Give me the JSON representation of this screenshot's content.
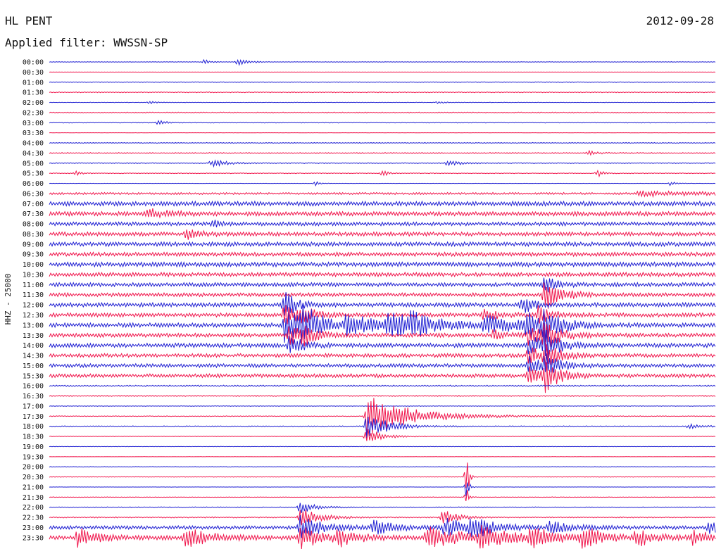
{
  "header": {
    "station": "HL PENT",
    "date": "2012-09-28",
    "filter": "Applied filter: WWSSN-SP"
  },
  "chart_data": {
    "type": "line",
    "title": "HL PENT",
    "ylabel": "HHZ - 25000",
    "x_range_minutes": [
      0,
      30
    ],
    "colors": {
      "even": "#1e1ed2",
      "odd": "#f0144b"
    },
    "rows": [
      {
        "label": "00:00",
        "noise": 0.4,
        "events": [
          {
            "t": 7.0,
            "a": 4,
            "d": 0.2
          },
          {
            "t": 8.5,
            "a": 6,
            "d": 0.4
          }
        ]
      },
      {
        "label": "00:30",
        "noise": 0.2,
        "events": []
      },
      {
        "label": "01:00",
        "noise": 0.5,
        "events": []
      },
      {
        "label": "01:30",
        "noise": 0.6,
        "events": []
      },
      {
        "label": "02:00",
        "noise": 0.3,
        "events": [
          {
            "t": 4.5,
            "a": 2,
            "d": 0.3
          },
          {
            "t": 17.5,
            "a": 2,
            "d": 0.3
          }
        ]
      },
      {
        "label": "02:30",
        "noise": 0.7,
        "events": []
      },
      {
        "label": "03:00",
        "noise": 0.5,
        "events": [
          {
            "t": 4.9,
            "a": 4,
            "d": 0.3
          }
        ]
      },
      {
        "label": "03:30",
        "noise": 0.2,
        "events": []
      },
      {
        "label": "04:00",
        "noise": 0.6,
        "events": []
      },
      {
        "label": "04:30",
        "noise": 0.8,
        "events": [
          {
            "t": 24.3,
            "a": 3,
            "d": 0.4
          }
        ]
      },
      {
        "label": "05:00",
        "noise": 0.6,
        "events": [
          {
            "t": 7.3,
            "a": 6,
            "d": 0.6
          },
          {
            "t": 17.9,
            "a": 4,
            "d": 0.6
          }
        ]
      },
      {
        "label": "05:30",
        "noise": 0.5,
        "events": [
          {
            "t": 1.2,
            "a": 4,
            "d": 0.2
          },
          {
            "t": 15.0,
            "a": 6,
            "d": 0.2
          },
          {
            "t": 24.7,
            "a": 6,
            "d": 0.2
          }
        ]
      },
      {
        "label": "06:00",
        "noise": 0.2,
        "events": [
          {
            "t": 12.0,
            "a": 3,
            "d": 0.2
          },
          {
            "t": 28.0,
            "a": 4,
            "d": 0.2
          }
        ]
      },
      {
        "label": "06:30",
        "noise": 1.5,
        "events": [
          {
            "t": 26.5,
            "a": 4,
            "d": 3.0
          }
        ]
      },
      {
        "label": "07:00",
        "noise": 3.2,
        "events": []
      },
      {
        "label": "07:30",
        "noise": 3.0,
        "events": [
          {
            "t": 4.4,
            "a": 7,
            "d": 0.8
          }
        ]
      },
      {
        "label": "08:00",
        "noise": 2.6,
        "events": [
          {
            "t": 7.4,
            "a": 4,
            "d": 0.3
          }
        ]
      },
      {
        "label": "08:30",
        "noise": 2.8,
        "events": [
          {
            "t": 6.2,
            "a": 6,
            "d": 0.6
          }
        ]
      },
      {
        "label": "09:00",
        "noise": 3.0,
        "events": []
      },
      {
        "label": "09:30",
        "noise": 2.8,
        "events": []
      },
      {
        "label": "10:00",
        "noise": 3.2,
        "events": []
      },
      {
        "label": "10:30",
        "noise": 2.9,
        "events": []
      },
      {
        "label": "11:00",
        "noise": 2.8,
        "events": [
          {
            "t": 22.3,
            "a": 12,
            "d": 0.5
          }
        ]
      },
      {
        "label": "11:30",
        "noise": 2.6,
        "events": [
          {
            "t": 22.3,
            "a": 30,
            "d": 0.6
          }
        ]
      },
      {
        "label": "12:00",
        "noise": 3.0,
        "events": [
          {
            "t": 10.6,
            "a": 20,
            "d": 0.5
          },
          {
            "t": 21.3,
            "a": 12,
            "d": 0.5
          }
        ]
      },
      {
        "label": "12:30",
        "noise": 2.8,
        "events": [
          {
            "t": 10.6,
            "a": 16,
            "d": 0.6
          },
          {
            "t": 11.3,
            "a": 12,
            "d": 0.5
          },
          {
            "t": 19.5,
            "a": 7,
            "d": 0.8
          },
          {
            "t": 22.0,
            "a": 12,
            "d": 0.6
          }
        ]
      },
      {
        "label": "13:00",
        "noise": 3.0,
        "events": [
          {
            "t": 10.6,
            "a": 24,
            "d": 0.8
          },
          {
            "t": 11.4,
            "a": 22,
            "d": 1.0
          },
          {
            "t": 13.4,
            "a": 14,
            "d": 1.5
          },
          {
            "t": 15.2,
            "a": 16,
            "d": 1.5
          },
          {
            "t": 16.3,
            "a": 10,
            "d": 1.0
          },
          {
            "t": 19.6,
            "a": 12,
            "d": 1.5
          },
          {
            "t": 21.5,
            "a": 16,
            "d": 0.8
          },
          {
            "t": 22.3,
            "a": 22,
            "d": 0.6
          }
        ]
      },
      {
        "label": "13:30",
        "noise": 2.8,
        "events": [
          {
            "t": 10.8,
            "a": 14,
            "d": 0.6
          },
          {
            "t": 11.4,
            "a": 12,
            "d": 0.6
          },
          {
            "t": 20.0,
            "a": 8,
            "d": 0.5
          },
          {
            "t": 21.6,
            "a": 16,
            "d": 0.6
          },
          {
            "t": 22.3,
            "a": 18,
            "d": 0.6
          }
        ]
      },
      {
        "label": "14:00",
        "noise": 3.0,
        "events": [
          {
            "t": 10.8,
            "a": 16,
            "d": 0.5
          },
          {
            "t": 21.6,
            "a": 16,
            "d": 0.6
          },
          {
            "t": 22.3,
            "a": 18,
            "d": 0.6
          }
        ]
      },
      {
        "label": "14:30",
        "noise": 2.6,
        "events": [
          {
            "t": 21.6,
            "a": 14,
            "d": 0.6
          },
          {
            "t": 22.3,
            "a": 16,
            "d": 0.6
          }
        ]
      },
      {
        "label": "15:00",
        "noise": 2.6,
        "events": [
          {
            "t": 21.6,
            "a": 12,
            "d": 0.6
          },
          {
            "t": 22.3,
            "a": 16,
            "d": 0.6
          }
        ]
      },
      {
        "label": "15:30",
        "noise": 2.6,
        "events": [
          {
            "t": 21.6,
            "a": 12,
            "d": 0.6
          },
          {
            "t": 22.3,
            "a": 22,
            "d": 0.6
          }
        ]
      },
      {
        "label": "16:00",
        "noise": 1.0,
        "events": []
      },
      {
        "label": "16:30",
        "noise": 0.8,
        "events": []
      },
      {
        "label": "17:00",
        "noise": 0.4,
        "events": []
      },
      {
        "label": "17:30",
        "noise": 0.5,
        "events": [
          {
            "t": 14.3,
            "a": 30,
            "d": 2.0
          }
        ]
      },
      {
        "label": "18:00",
        "noise": 0.7,
        "events": [
          {
            "t": 14.3,
            "a": 18,
            "d": 1.0
          },
          {
            "t": 28.8,
            "a": 3,
            "d": 0.6
          }
        ]
      },
      {
        "label": "18:30",
        "noise": 0.4,
        "events": [
          {
            "t": 14.3,
            "a": 14,
            "d": 0.6
          }
        ]
      },
      {
        "label": "19:00",
        "noise": 0.3,
        "events": []
      },
      {
        "label": "19:30",
        "noise": 0.2,
        "events": []
      },
      {
        "label": "20:00",
        "noise": 0.4,
        "events": []
      },
      {
        "label": "20:30",
        "noise": 0.4,
        "events": [
          {
            "t": 18.8,
            "a": 36,
            "d": 0.1
          }
        ]
      },
      {
        "label": "21:00",
        "noise": 0.2,
        "events": [
          {
            "t": 18.8,
            "a": 20,
            "d": 0.1
          }
        ]
      },
      {
        "label": "21:30",
        "noise": 0.4,
        "events": [
          {
            "t": 18.8,
            "a": 14,
            "d": 0.1
          }
        ]
      },
      {
        "label": "22:00",
        "noise": 0.6,
        "events": [
          {
            "t": 11.3,
            "a": 10,
            "d": 0.6
          }
        ]
      },
      {
        "label": "22:30",
        "noise": 0.8,
        "events": [
          {
            "t": 11.3,
            "a": 14,
            "d": 0.8
          },
          {
            "t": 17.7,
            "a": 12,
            "d": 0.6
          }
        ]
      },
      {
        "label": "23:00",
        "noise": 2.5,
        "events": [
          {
            "t": 11.3,
            "a": 16,
            "d": 1.0
          },
          {
            "t": 14.6,
            "a": 10,
            "d": 1.0
          },
          {
            "t": 17.8,
            "a": 14,
            "d": 1.0
          },
          {
            "t": 19.0,
            "a": 14,
            "d": 1.0
          },
          {
            "t": 22.5,
            "a": 8,
            "d": 1.0
          },
          {
            "t": 29.7,
            "a": 10,
            "d": 0.6
          }
        ]
      },
      {
        "label": "23:30",
        "noise": 3.0,
        "events": [
          {
            "t": 1.3,
            "a": 14,
            "d": 0.8
          },
          {
            "t": 6.1,
            "a": 14,
            "d": 1.0
          },
          {
            "t": 11.3,
            "a": 16,
            "d": 1.0
          },
          {
            "t": 13.0,
            "a": 10,
            "d": 0.8
          },
          {
            "t": 17.0,
            "a": 16,
            "d": 1.5
          },
          {
            "t": 19.4,
            "a": 14,
            "d": 1.2
          },
          {
            "t": 21.7,
            "a": 14,
            "d": 1.0
          },
          {
            "t": 24.0,
            "a": 16,
            "d": 0.8
          },
          {
            "t": 26.4,
            "a": 12,
            "d": 0.8
          },
          {
            "t": 29.0,
            "a": 10,
            "d": 0.8
          }
        ]
      }
    ]
  }
}
